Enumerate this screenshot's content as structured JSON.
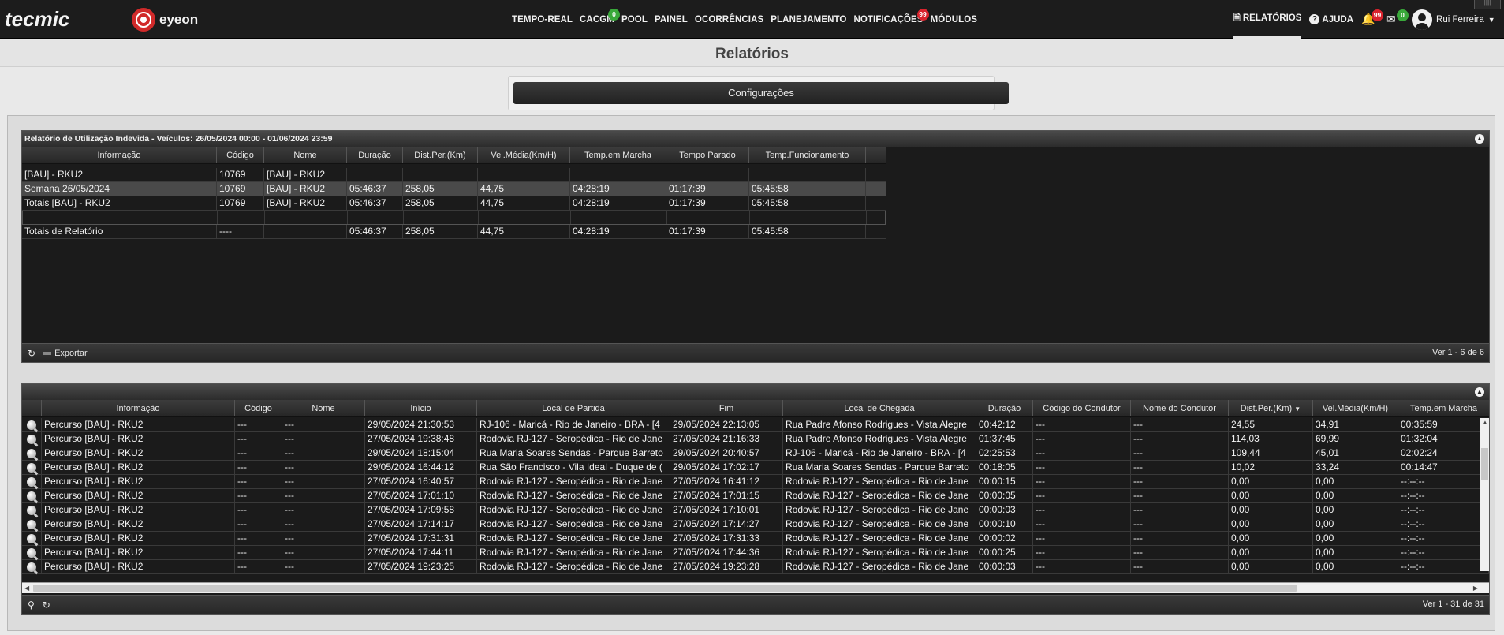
{
  "brand": {
    "tecmic": "tecmic",
    "eyeon": "eyeon"
  },
  "nav": [
    {
      "label": "TEMPO-REAL",
      "badge": ""
    },
    {
      "label": "CACGM",
      "badge": "0"
    },
    {
      "label": "POOL",
      "badge": ""
    },
    {
      "label": "PAINEL",
      "badge": ""
    },
    {
      "label": "OCORRÊNCIAS",
      "badge": ""
    },
    {
      "label": "PLANEJAMENTO",
      "badge": ""
    },
    {
      "label": "NOTIFICAÇÕES",
      "badge": "99"
    },
    {
      "label": "MÓDULOS",
      "badge": ""
    }
  ],
  "right_nav": {
    "reports": "RELATÓRIOS",
    "help": "AJUDA",
    "alerts_badge": "99",
    "messages_badge": "0",
    "user": "Rui Ferreira"
  },
  "page": {
    "title": "Relatórios",
    "config_button": "Configurações"
  },
  "grid1": {
    "title": "Relatório de Utilização Indevida - Veículos: 26/05/2024 00:00 - 01/06/2024 23:59",
    "columns": [
      "Informação",
      "Código",
      "Nome",
      "Duração",
      "Dist.Per.(Km)",
      "Vel.Média(Km/H)",
      "Temp.em Marcha",
      "Tempo Parado",
      "Temp.Funcionamento"
    ],
    "rows": [
      [
        "[BAU] - RKU2",
        "10769",
        "[BAU] - RKU2",
        "",
        "",
        "",
        "",
        "",
        ""
      ],
      [
        "Semana 26/05/2024",
        "10769",
        "[BAU] - RKU2",
        "05:46:37",
        "258,05",
        "44,75",
        "04:28:19",
        "01:17:39",
        "05:45:58"
      ],
      [
        "Totais [BAU] - RKU2",
        "10769",
        "[BAU] - RKU2",
        "05:46:37",
        "258,05",
        "44,75",
        "04:28:19",
        "01:17:39",
        "05:45:58"
      ],
      [
        "",
        "",
        "",
        "",
        "",
        "",
        "",
        "",
        ""
      ],
      [
        "Totais de Relatório",
        "----",
        "",
        "05:46:37",
        "258,05",
        "44,75",
        "04:28:19",
        "01:17:39",
        "05:45:58"
      ]
    ],
    "export_label": "Exportar",
    "pager": "Ver 1 - 6 de 6"
  },
  "grid2": {
    "columns": [
      "Informação",
      "Código",
      "Nome",
      "Início",
      "Local de Partida",
      "Fim",
      "Local de Chegada",
      "Duração",
      "Código do Condutor",
      "Nome do Condutor",
      "Dist.Per.(Km)",
      "Vel.Média(Km/H)",
      "Temp.em Marcha"
    ],
    "rows": [
      [
        "Percurso [BAU] - RKU2",
        "---",
        "---",
        "29/05/2024 21:30:53",
        "RJ-106 - Maricá - Rio de Janeiro - BRA - [4",
        "29/05/2024 22:13:05",
        "Rua Padre Afonso Rodrigues - Vista Alegre",
        "00:42:12",
        "---",
        "---",
        "24,55",
        "34,91",
        "00:35:59"
      ],
      [
        "Percurso [BAU] - RKU2",
        "---",
        "---",
        "27/05/2024 19:38:48",
        "Rodovia RJ-127 - Seropédica - Rio de Jane",
        "27/05/2024 21:16:33",
        "Rua Padre Afonso Rodrigues - Vista Alegre",
        "01:37:45",
        "---",
        "---",
        "114,03",
        "69,99",
        "01:32:04"
      ],
      [
        "Percurso [BAU] - RKU2",
        "---",
        "---",
        "29/05/2024 18:15:04",
        "Rua Maria Soares Sendas - Parque Barreto",
        "29/05/2024 20:40:57",
        "RJ-106 - Maricá - Rio de Janeiro - BRA - [4",
        "02:25:53",
        "---",
        "---",
        "109,44",
        "45,01",
        "02:02:24"
      ],
      [
        "Percurso [BAU] - RKU2",
        "---",
        "---",
        "29/05/2024 16:44:12",
        "Rua São Francisco - Vila Ideal - Duque de (",
        "29/05/2024 17:02:17",
        "Rua Maria Soares Sendas - Parque Barreto",
        "00:18:05",
        "---",
        "---",
        "10,02",
        "33,24",
        "00:14:47"
      ],
      [
        "Percurso [BAU] - RKU2",
        "---",
        "---",
        "27/05/2024 16:40:57",
        "Rodovia RJ-127 - Seropédica - Rio de Jane",
        "27/05/2024 16:41:12",
        "Rodovia RJ-127 - Seropédica - Rio de Jane",
        "00:00:15",
        "---",
        "---",
        "0,00",
        "0,00",
        "--:--:--"
      ],
      [
        "Percurso [BAU] - RKU2",
        "---",
        "---",
        "27/05/2024 17:01:10",
        "Rodovia RJ-127 - Seropédica - Rio de Jane",
        "27/05/2024 17:01:15",
        "Rodovia RJ-127 - Seropédica - Rio de Jane",
        "00:00:05",
        "---",
        "---",
        "0,00",
        "0,00",
        "--:--:--"
      ],
      [
        "Percurso [BAU] - RKU2",
        "---",
        "---",
        "27/05/2024 17:09:58",
        "Rodovia RJ-127 - Seropédica - Rio de Jane",
        "27/05/2024 17:10:01",
        "Rodovia RJ-127 - Seropédica - Rio de Jane",
        "00:00:03",
        "---",
        "---",
        "0,00",
        "0,00",
        "--:--:--"
      ],
      [
        "Percurso [BAU] - RKU2",
        "---",
        "---",
        "27/05/2024 17:14:17",
        "Rodovia RJ-127 - Seropédica - Rio de Jane",
        "27/05/2024 17:14:27",
        "Rodovia RJ-127 - Seropédica - Rio de Jane",
        "00:00:10",
        "---",
        "---",
        "0,00",
        "0,00",
        "--:--:--"
      ],
      [
        "Percurso [BAU] - RKU2",
        "---",
        "---",
        "27/05/2024 17:31:31",
        "Rodovia RJ-127 - Seropédica - Rio de Jane",
        "27/05/2024 17:31:33",
        "Rodovia RJ-127 - Seropédica - Rio de Jane",
        "00:00:02",
        "---",
        "---",
        "0,00",
        "0,00",
        "--:--:--"
      ],
      [
        "Percurso [BAU] - RKU2",
        "---",
        "---",
        "27/05/2024 17:44:11",
        "Rodovia RJ-127 - Seropédica - Rio de Jane",
        "27/05/2024 17:44:36",
        "Rodovia RJ-127 - Seropédica - Rio de Jane",
        "00:00:25",
        "---",
        "---",
        "0,00",
        "0,00",
        "--:--:--"
      ],
      [
        "Percurso [BAU] - RKU2",
        "---",
        "---",
        "27/05/2024 19:23:25",
        "Rodovia RJ-127 - Seropédica - Rio de Jane",
        "27/05/2024 19:23:28",
        "Rodovia RJ-127 - Seropédica - Rio de Jane",
        "00:00:03",
        "---",
        "---",
        "0,00",
        "0,00",
        "--:--:--"
      ]
    ],
    "pager": "Ver 1 - 31 de 31"
  }
}
